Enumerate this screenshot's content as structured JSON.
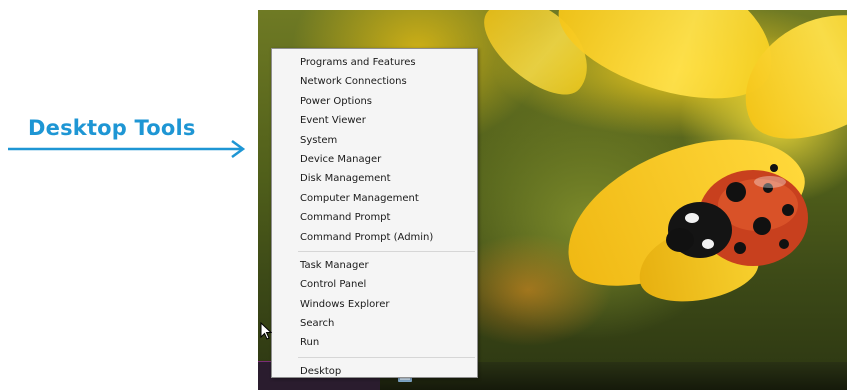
{
  "annotation": {
    "label": "Desktop Tools",
    "color": "#1e96d4"
  },
  "context_menu": {
    "groups": [
      [
        "Programs and Features",
        "Network Connections",
        "Power Options",
        "Event Viewer",
        "System",
        "Device Manager",
        "Disk Management",
        "Computer Management",
        "Command Prompt",
        "Command Prompt (Admin)"
      ],
      [
        "Task Manager",
        "Control Panel",
        "Windows Explorer",
        "Search",
        "Run"
      ],
      [
        "Desktop"
      ]
    ]
  },
  "icons": {
    "arrow": "right-arrow-icon",
    "cursor": "mouse-pointer-icon",
    "taskbar_app": "app-icon"
  },
  "colors": {
    "menu_background": "#f5f5f5",
    "menu_border": "#8f8f8f",
    "start_accent": "#7a2d76"
  }
}
